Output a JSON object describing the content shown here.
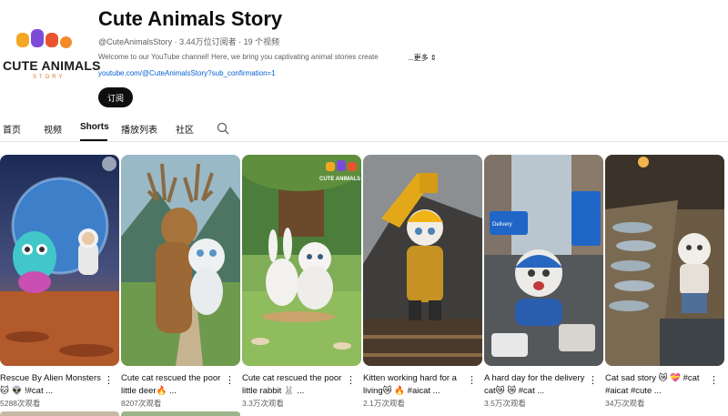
{
  "channel": {
    "logo_text": "CUTE ANIMALS",
    "logo_sub": "STORY",
    "title": "Cute Animals Story",
    "meta": "@CuteAnimalsStory · 3.44万位订阅者 · 19 个视频",
    "description": "Welcome to our YouTube channel! Here, we bring you captivating animal stories create",
    "more_label": "...更多",
    "link": "youtube.com/@CuteAnimalsStory?sub_confirmation=1",
    "subscribe_label": "订阅"
  },
  "tabs": [
    {
      "label": "首页"
    },
    {
      "label": "视频"
    },
    {
      "label": "Shorts"
    },
    {
      "label": "播放列表"
    },
    {
      "label": "社区"
    }
  ],
  "shorts": [
    {
      "title": "Rescue By Alien Monsters 🐱 👽 !#cat ...",
      "views": "5288次观看",
      "thumb_icon": "alien-cat-space-thumbnail"
    },
    {
      "title": "Cute cat rescued the poor little deer🔥 ...",
      "views": "8207次观看",
      "thumb_icon": "cat-deer-thumbnail"
    },
    {
      "title": "Cute cat rescued the poor little rabbit 🐰 ...",
      "views": "3.3万次观看",
      "thumb_icon": "cat-rabbit-thumbnail"
    },
    {
      "title": "Kitten working hard for a living😿 🔥 #aicat ...",
      "views": "2.1万次观看",
      "thumb_icon": "kitten-worker-thumbnail"
    },
    {
      "title": "A hard day for the delivery cat😿 😿 #cat ...",
      "views": "3.5万次观看",
      "thumb_icon": "delivery-cat-thumbnail"
    },
    {
      "title": "Cat sad story 😿 💝 #cat #aicat #cute ...",
      "views": "34万次观看",
      "thumb_icon": "sad-cat-market-thumbnail"
    }
  ],
  "thumb_watermark": "CUTE ANIMALS",
  "delivery_sign": "Delivery",
  "colors": {
    "link": "#065fd4",
    "subscribe_bg": "#0f0f0f",
    "secondary_text": "#606060"
  }
}
